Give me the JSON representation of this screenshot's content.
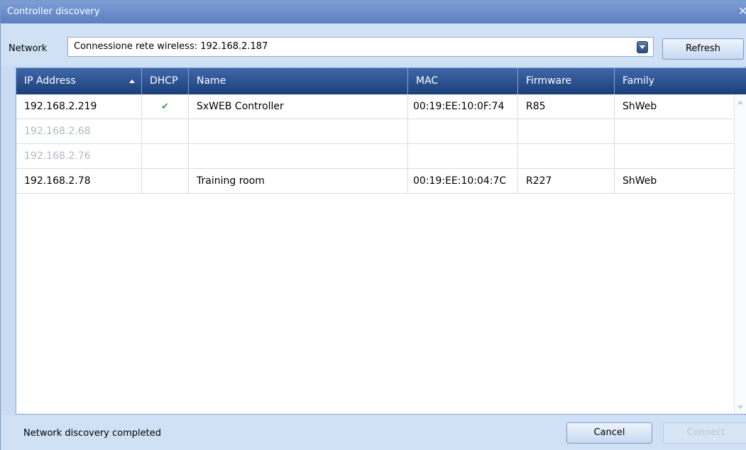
{
  "window": {
    "title": "Controller discovery",
    "close_glyph": "✕"
  },
  "network": {
    "label": "Network",
    "selected": "Connessione rete wireless: 192.168.2.187",
    "refresh_label": "Refresh"
  },
  "table": {
    "columns": [
      "IP Address",
      "DHCP",
      "Name",
      "MAC",
      "Firmware",
      "Family"
    ],
    "sort_column": "IP Address",
    "rows": [
      {
        "ip": "192.168.2.219",
        "dhcp": "✔",
        "name": "SxWEB Controller",
        "mac": "00:19:EE:10:0F:74",
        "firmware": "R85",
        "family": "ShWeb"
      },
      {
        "ip": "192.168.2.68",
        "dhcp": "",
        "name": "",
        "mac": "",
        "firmware": "",
        "family": ""
      },
      {
        "ip": "192.168.2.76",
        "dhcp": "",
        "name": "",
        "mac": "",
        "firmware": "",
        "family": ""
      },
      {
        "ip": "192.168.2.78",
        "dhcp": "",
        "name": "Training room",
        "mac": "00:19:EE:10:04:7C",
        "firmware": "R227",
        "family": "ShWeb"
      }
    ]
  },
  "status": {
    "text": "Network discovery completed"
  },
  "buttons": {
    "cancel_label": "Cancel",
    "connect_label": "Connect"
  },
  "colors": {
    "header": "#2a4f8d",
    "title_bar": "#6d90cc",
    "dhcp_check": "#3f9a3f"
  }
}
